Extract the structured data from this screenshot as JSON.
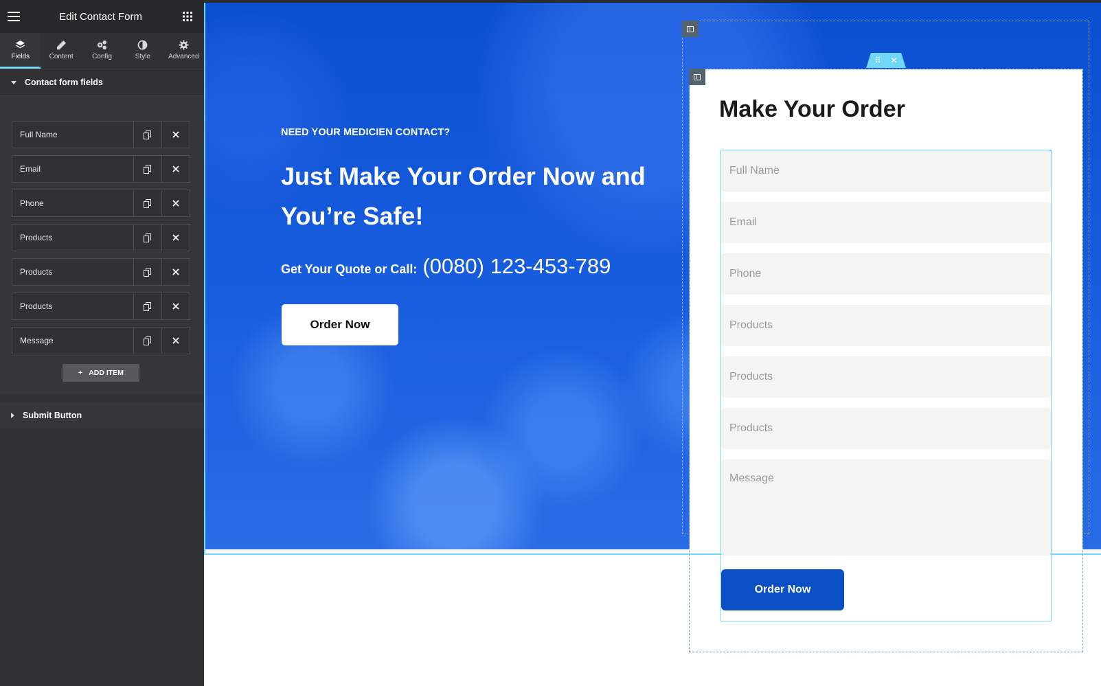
{
  "sidebar": {
    "title": "Edit Contact Form",
    "tabs": [
      {
        "label": "Fields",
        "icon": "layers-icon",
        "active": true
      },
      {
        "label": "Content",
        "icon": "pencil-icon",
        "active": false
      },
      {
        "label": "Config",
        "icon": "cogs-icon",
        "active": false
      },
      {
        "label": "Style",
        "icon": "contrast-icon",
        "active": false
      },
      {
        "label": "Advanced",
        "icon": "gear-icon",
        "active": false
      }
    ],
    "fields_section": "Contact form fields",
    "items": [
      "Full Name",
      "Email",
      "Phone",
      "Products",
      "Products",
      "Products",
      "Message"
    ],
    "add_item": "ADD ITEM",
    "submit_section": "Submit Button"
  },
  "hero": {
    "eyebrow": "NEED YOUR MEDICIEN CONTACT?",
    "title": "Just Make Your Order Now and You’re Safe!",
    "quote_label": "Get Your Quote or Call:",
    "phone": "(0080) 123-453-789",
    "button": "Order Now"
  },
  "form": {
    "title": "Make Your Order",
    "placeholders": {
      "full_name": "Full Name",
      "email": "Email",
      "phone": "Phone",
      "product_1": "Products",
      "product_2": "Products",
      "product_3": "Products",
      "message": "Message"
    },
    "submit": "Order Now"
  },
  "colors": {
    "accent": "#71d7f7",
    "brand_blue": "#0a4fc4",
    "sidebar_bg": "#2f3133"
  }
}
